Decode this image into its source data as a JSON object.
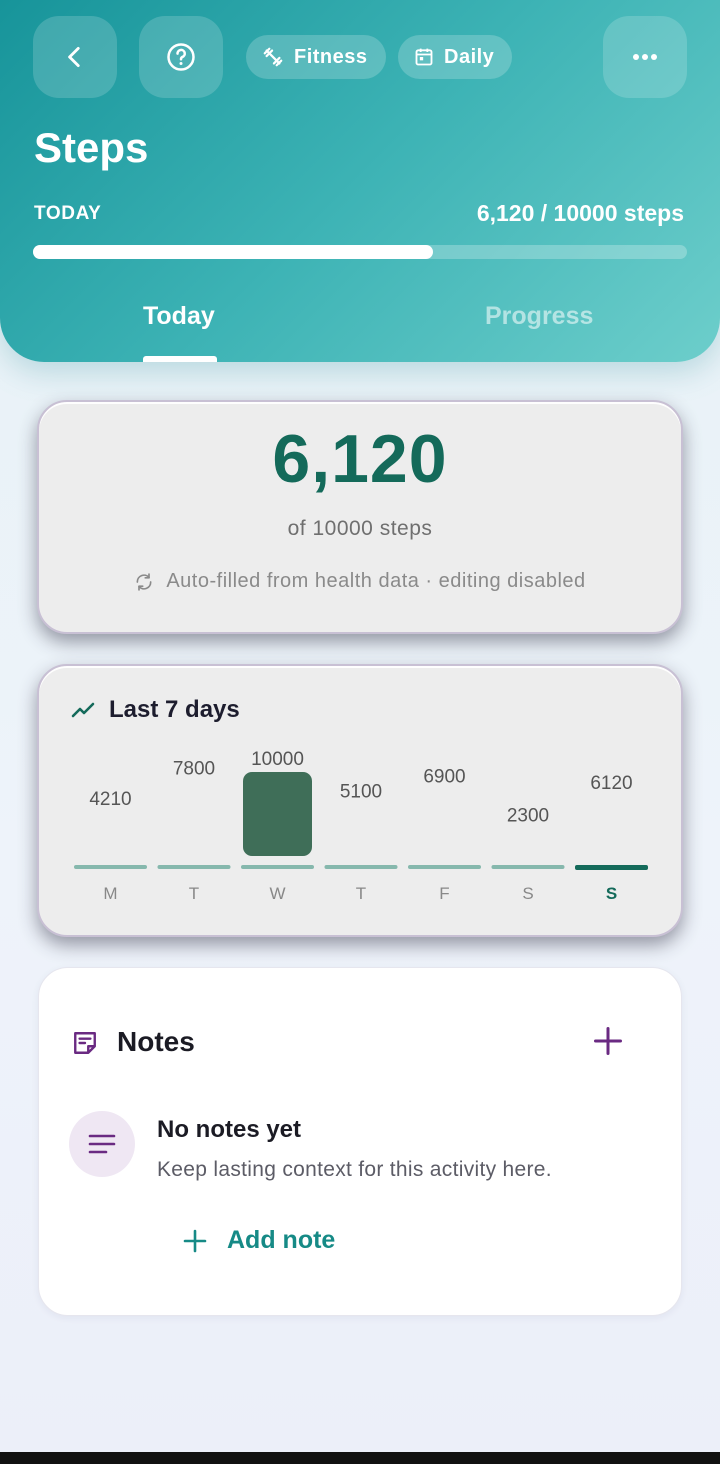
{
  "header": {
    "back_icon": "chevron-left-icon",
    "help_icon": "help-circle-icon",
    "more_icon": "more-horizontal-icon",
    "chips": [
      {
        "label": "Fitness",
        "icon": "fitness-icon"
      },
      {
        "label": "Daily",
        "icon": "calendar-icon"
      }
    ],
    "title": "Steps",
    "progress_label": "TODAY",
    "progress_value": "6,120 / 10000 steps",
    "progress_fraction": 0.612
  },
  "tabs": [
    {
      "label": "Today",
      "active": true
    },
    {
      "label": "Progress",
      "active": false
    }
  ],
  "summary": {
    "value": "6,120",
    "goal_text": "of 10000 steps",
    "autofill_text": "Auto-filled from health data · editing disabled",
    "autofill_icon": "sync-icon"
  },
  "chart_data": {
    "type": "bar",
    "title": "Last 7 days",
    "categories": [
      "M",
      "T",
      "W",
      "T",
      "F",
      "S",
      "S"
    ],
    "values": [
      4210,
      7800,
      10000,
      5100,
      6900,
      2300,
      6120
    ],
    "goal": 10000,
    "highlight_index": 6,
    "colors": {
      "goal_bar": "#3f6e58",
      "today_line": "#146a5a",
      "base_line": "#86b8ad",
      "label": "#555555",
      "day_label": "#888888"
    }
  },
  "notes": {
    "title": "Notes",
    "icon": "notes-icon",
    "add_icon": "plus-icon",
    "empty_icon": "lines-icon",
    "empty_title": "No notes yet",
    "empty_subtitle": "Keep lasting context for this activity here.",
    "add_label": "Add note"
  },
  "colors": {
    "accent": "#17949a",
    "primary_text": "#146a5a",
    "notes_accent": "#6a2a82",
    "add_note": "#168a86"
  }
}
